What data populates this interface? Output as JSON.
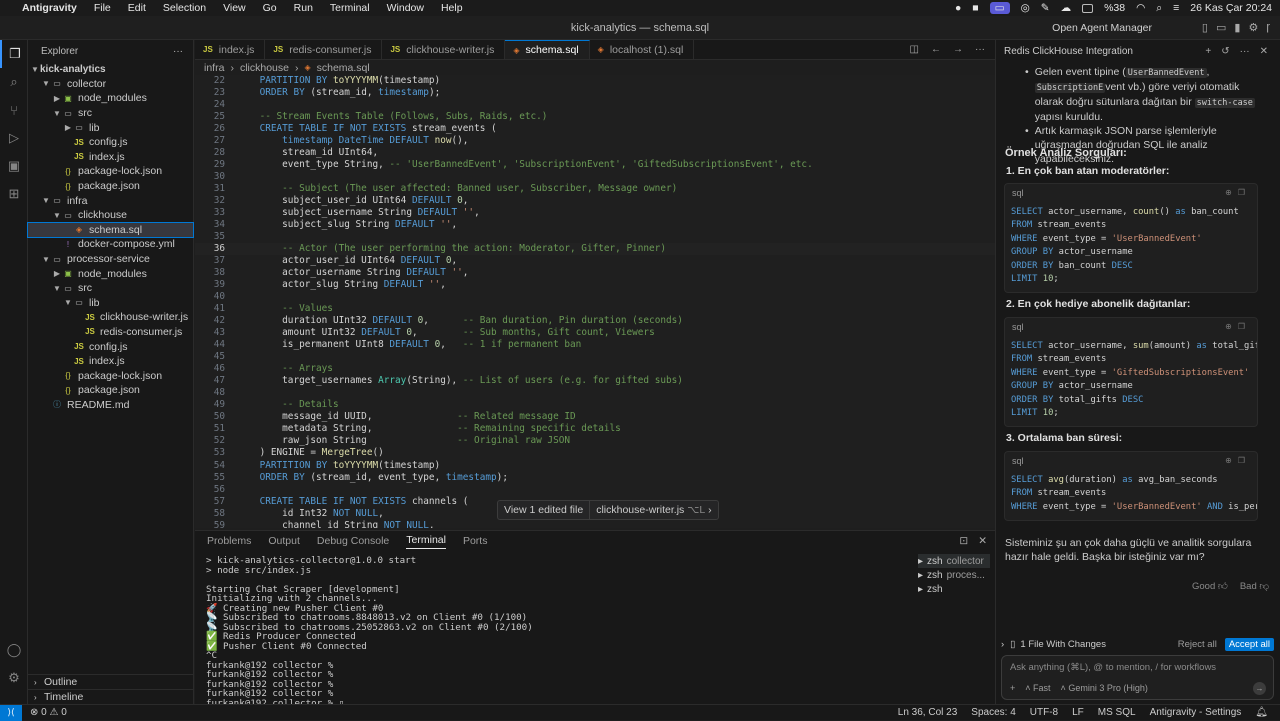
{
  "menubar": {
    "app": "Antigravity",
    "items": [
      "File",
      "Edit",
      "Selection",
      "View",
      "Go",
      "Run",
      "Terminal",
      "Window",
      "Help"
    ],
    "battery": "%38",
    "clock": "26 Kas Çar  20:24"
  },
  "window": {
    "title": "kick-analytics — schema.sql",
    "open_agent_manager": "Open Agent Manager"
  },
  "explorer": {
    "title": "Explorer",
    "root": "kick-analytics",
    "rows": [
      {
        "label": "collector",
        "kind": "folder",
        "depth": 1,
        "open": true
      },
      {
        "label": "node_modules",
        "kind": "node",
        "depth": 2,
        "open": false
      },
      {
        "label": "src",
        "kind": "folder",
        "depth": 2,
        "open": true
      },
      {
        "label": "lib",
        "kind": "folder",
        "depth": 3,
        "open": false
      },
      {
        "label": "config.js",
        "kind": "js",
        "depth": 3
      },
      {
        "label": "index.js",
        "kind": "js",
        "depth": 3
      },
      {
        "label": "package-lock.json",
        "kind": "json",
        "depth": 2
      },
      {
        "label": "package.json",
        "kind": "json",
        "depth": 2
      },
      {
        "label": "infra",
        "kind": "folder",
        "depth": 1,
        "open": true
      },
      {
        "label": "clickhouse",
        "kind": "folder",
        "depth": 2,
        "open": true
      },
      {
        "label": "schema.sql",
        "kind": "sql",
        "depth": 3,
        "selected": true
      },
      {
        "label": "docker-compose.yml",
        "kind": "yml",
        "depth": 2
      },
      {
        "label": "processor-service",
        "kind": "folder",
        "depth": 1,
        "open": true
      },
      {
        "label": "node_modules",
        "kind": "node",
        "depth": 2,
        "open": false
      },
      {
        "label": "src",
        "kind": "folder",
        "depth": 2,
        "open": true
      },
      {
        "label": "lib",
        "kind": "folder",
        "depth": 3,
        "open": true
      },
      {
        "label": "clickhouse-writer.js",
        "kind": "js",
        "depth": 4
      },
      {
        "label": "redis-consumer.js",
        "kind": "js",
        "depth": 4
      },
      {
        "label": "config.js",
        "kind": "js",
        "depth": 3
      },
      {
        "label": "index.js",
        "kind": "js",
        "depth": 3
      },
      {
        "label": "package-lock.json",
        "kind": "json",
        "depth": 2
      },
      {
        "label": "package.json",
        "kind": "json",
        "depth": 2
      },
      {
        "label": "README.md",
        "kind": "md",
        "depth": 1
      }
    ],
    "outline": "Outline",
    "timeline": "Timeline"
  },
  "tabs": [
    {
      "label": "index.js",
      "kind": "js"
    },
    {
      "label": "redis-consumer.js",
      "kind": "js"
    },
    {
      "label": "clickhouse-writer.js",
      "kind": "js"
    },
    {
      "label": "schema.sql",
      "kind": "sql",
      "active": true
    },
    {
      "label": "localhost (1).sql",
      "kind": "sql"
    }
  ],
  "breadcrumb": [
    "infra",
    "clickhouse",
    "schema.sql"
  ],
  "editor": {
    "current_line": 36,
    "lines": [
      {
        "n": 22,
        "t": [
          [
            "    ",
            ""
          ],
          [
            "PARTITION BY ",
            "kw"
          ],
          [
            "toYYYYMM",
            "fn"
          ],
          [
            "(timestamp)",
            ""
          ]
        ]
      },
      {
        "n": 23,
        "t": [
          [
            "    ",
            ""
          ],
          [
            "ORDER BY ",
            "kw"
          ],
          [
            "(stream_id, ",
            ""
          ],
          [
            "timestamp",
            "kw"
          ],
          [
            ");",
            ""
          ]
        ]
      },
      {
        "n": 24,
        "t": [
          [
            "",
            ""
          ]
        ]
      },
      {
        "n": 25,
        "t": [
          [
            "    ",
            ""
          ],
          [
            "-- Stream Events Table (Follows, Subs, Raids, etc.)",
            "cm"
          ]
        ]
      },
      {
        "n": 26,
        "t": [
          [
            "    ",
            ""
          ],
          [
            "CREATE TABLE IF NOT EXISTS ",
            "kw"
          ],
          [
            "stream_events (",
            ""
          ]
        ]
      },
      {
        "n": 27,
        "t": [
          [
            "        ",
            ""
          ],
          [
            "timestamp DateTime ",
            "kw"
          ],
          [
            "DEFAULT ",
            "kw"
          ],
          [
            "now",
            "fn"
          ],
          [
            "(),",
            ""
          ]
        ]
      },
      {
        "n": 28,
        "t": [
          [
            "        stream_id UInt64,",
            ""
          ]
        ]
      },
      {
        "n": 29,
        "t": [
          [
            "        event_type String, ",
            ""
          ],
          [
            "-- 'UserBannedEvent', 'SubscriptionEvent', 'GiftedSubscriptionsEvent', etc.",
            "cm"
          ]
        ]
      },
      {
        "n": 30,
        "t": [
          [
            "",
            ""
          ]
        ]
      },
      {
        "n": 31,
        "t": [
          [
            "        ",
            ""
          ],
          [
            "-- Subject (The user affected: Banned user, Subscriber, Message owner)",
            "cm"
          ]
        ]
      },
      {
        "n": 32,
        "t": [
          [
            "        subject_user_id UInt64 ",
            ""
          ],
          [
            "DEFAULT ",
            "kw"
          ],
          [
            "0",
            "num"
          ],
          [
            ",",
            ""
          ]
        ]
      },
      {
        "n": 33,
        "t": [
          [
            "        subject_username String ",
            ""
          ],
          [
            "DEFAULT ",
            "kw"
          ],
          [
            "''",
            "str"
          ],
          [
            ",",
            ""
          ]
        ]
      },
      {
        "n": 34,
        "t": [
          [
            "        subject_slug String ",
            ""
          ],
          [
            "DEFAULT ",
            "kw"
          ],
          [
            "''",
            "str"
          ],
          [
            ",",
            ""
          ]
        ]
      },
      {
        "n": 35,
        "t": [
          [
            "",
            ""
          ]
        ]
      },
      {
        "n": 36,
        "t": [
          [
            "        ",
            ""
          ],
          [
            "-- Actor (The user performing the action: Moderator, Gifter, Pinner)",
            "cm"
          ]
        ]
      },
      {
        "n": 37,
        "t": [
          [
            "        actor_user_id UInt64 ",
            ""
          ],
          [
            "DEFAULT ",
            "kw"
          ],
          [
            "0",
            "num"
          ],
          [
            ",",
            ""
          ]
        ]
      },
      {
        "n": 38,
        "t": [
          [
            "        actor_username String ",
            ""
          ],
          [
            "DEFAULT ",
            "kw"
          ],
          [
            "''",
            "str"
          ],
          [
            ",",
            ""
          ]
        ]
      },
      {
        "n": 39,
        "t": [
          [
            "        actor_slug String ",
            ""
          ],
          [
            "DEFAULT ",
            "kw"
          ],
          [
            "''",
            "str"
          ],
          [
            ",",
            ""
          ]
        ]
      },
      {
        "n": 40,
        "t": [
          [
            "",
            ""
          ]
        ]
      },
      {
        "n": 41,
        "t": [
          [
            "        ",
            ""
          ],
          [
            "-- Values",
            "cm"
          ]
        ]
      },
      {
        "n": 42,
        "t": [
          [
            "        duration UInt32 ",
            ""
          ],
          [
            "DEFAULT ",
            "kw"
          ],
          [
            "0",
            "num"
          ],
          [
            ",      ",
            ""
          ],
          [
            "-- Ban duration, Pin duration (seconds)",
            "cm"
          ]
        ]
      },
      {
        "n": 43,
        "t": [
          [
            "        amount UInt32 ",
            ""
          ],
          [
            "DEFAULT ",
            "kw"
          ],
          [
            "0",
            "num"
          ],
          [
            ",        ",
            ""
          ],
          [
            "-- Sub months, Gift count, Viewers",
            "cm"
          ]
        ]
      },
      {
        "n": 44,
        "t": [
          [
            "        is_permanent UInt8 ",
            ""
          ],
          [
            "DEFAULT ",
            "kw"
          ],
          [
            "0",
            "num"
          ],
          [
            ",   ",
            ""
          ],
          [
            "-- 1 if permanent ban",
            "cm"
          ]
        ]
      },
      {
        "n": 45,
        "t": [
          [
            "",
            ""
          ]
        ]
      },
      {
        "n": 46,
        "t": [
          [
            "        ",
            ""
          ],
          [
            "-- Arrays",
            "cm"
          ]
        ]
      },
      {
        "n": 47,
        "t": [
          [
            "        target_usernames ",
            ""
          ],
          [
            "Array",
            "ty"
          ],
          [
            "(String), ",
            ""
          ],
          [
            "-- List of users (e.g. for gifted subs)",
            "cm"
          ]
        ]
      },
      {
        "n": 48,
        "t": [
          [
            "",
            ""
          ]
        ]
      },
      {
        "n": 49,
        "t": [
          [
            "        ",
            ""
          ],
          [
            "-- Details",
            "cm"
          ]
        ]
      },
      {
        "n": 50,
        "t": [
          [
            "        message_id UUID,               ",
            ""
          ],
          [
            "-- Related message ID",
            "cm"
          ]
        ]
      },
      {
        "n": 51,
        "t": [
          [
            "        metadata String,               ",
            ""
          ],
          [
            "-- Remaining specific details",
            "cm"
          ]
        ]
      },
      {
        "n": 52,
        "t": [
          [
            "        raw_json String                ",
            ""
          ],
          [
            "-- Original raw JSON",
            "cm"
          ]
        ]
      },
      {
        "n": 53,
        "t": [
          [
            "    ) ENGINE = ",
            ""
          ],
          [
            "MergeTree",
            "fn"
          ],
          [
            "()",
            ""
          ]
        ]
      },
      {
        "n": 54,
        "t": [
          [
            "    ",
            ""
          ],
          [
            "PARTITION BY ",
            "kw"
          ],
          [
            "toYYYYMM",
            "fn"
          ],
          [
            "(timestamp)",
            ""
          ]
        ]
      },
      {
        "n": 55,
        "t": [
          [
            "    ",
            ""
          ],
          [
            "ORDER BY ",
            "kw"
          ],
          [
            "(stream_id, event_type, ",
            ""
          ],
          [
            "timestamp",
            "kw"
          ],
          [
            ");",
            ""
          ]
        ]
      },
      {
        "n": 56,
        "t": [
          [
            "",
            ""
          ]
        ]
      },
      {
        "n": 57,
        "t": [
          [
            "    ",
            ""
          ],
          [
            "CREATE TABLE IF NOT EXISTS ",
            "kw"
          ],
          [
            "channels (",
            ""
          ]
        ]
      },
      {
        "n": 58,
        "t": [
          [
            "        id Int32 ",
            ""
          ],
          [
            "NOT NULL",
            "kw"
          ],
          [
            ",",
            ""
          ]
        ]
      },
      {
        "n": 59,
        "t": [
          [
            "        channel_id String ",
            ""
          ],
          [
            "NOT NULL",
            "kw"
          ],
          [
            ",",
            ""
          ]
        ]
      }
    ]
  },
  "floatbar": {
    "edited": "View 1 edited file",
    "file": "clickhouse-writer.js",
    "shortcut": "⌥L"
  },
  "panel": {
    "tabs": [
      "Problems",
      "Output",
      "Debug Console",
      "Terminal",
      "Ports"
    ],
    "active": "Terminal",
    "terminal_lines": [
      "> kick-analytics-collector@1.0.0 start",
      "> node src/index.js",
      "",
      "Starting Chat Scraper [development]",
      "Initializing with 2 channels...",
      "🚀 Creating new Pusher Client #0",
      "📡 Subscribed to chatrooms.8848013.v2 on Client #0 (1/100)",
      "📡 Subscribed to chatrooms.25052863.v2 on Client #0 (2/100)",
      "✅ Redis Producer Connected",
      "✅ Pusher Client #0 Connected",
      "^C",
      "furkank@192 collector %",
      "furkank@192 collector %",
      "furkank@192 collector %",
      "furkank@192 collector %",
      "furkank@192 collector % ▯"
    ],
    "terminals": [
      {
        "name": "zsh",
        "sub": "collector"
      },
      {
        "name": "zsh",
        "sub": "proces..."
      },
      {
        "name": "zsh",
        "sub": ""
      }
    ]
  },
  "agent": {
    "title": "Redis ClickHouse Integration",
    "bullet1_a": "Gelen event tipine (",
    "bullet1_code1": "UserBannedEvent",
    "bullet1_b": ", ",
    "bullet1_code2": "SubscriptionE",
    "bullet1_c": "vent vb.) göre veriyi otomatik olarak doğru sütunlara dağıtan bir ",
    "bullet1_code3": "switch-case",
    "bullet1_d": " yapısı kuruldu.",
    "bullet2": "Artık karmaşık JSON parse işlemleriyle uğraşmadan doğrudan SQL ile analiz yapabileceksiniz.",
    "heading": "Örnek Analiz Sorguları:",
    "q1": "1. En çok ban atan moderatörler:",
    "q2": "2. En çok hediye abonelik dağıtanlar:",
    "q3": "3. Ortalama ban süresi:",
    "lang": "sql",
    "sql1": [
      "SELECT actor_username, count() as ban_count",
      "FROM stream_events",
      "WHERE event_type = 'UserBannedEvent'",
      "GROUP BY actor_username",
      "ORDER BY ban_count DESC",
      "LIMIT 10;"
    ],
    "sql2": [
      "SELECT actor_username, sum(amount) as total_gifts",
      "FROM stream_events",
      "WHERE event_type = 'GiftedSubscriptionsEvent'",
      "GROUP BY actor_username",
      "ORDER BY total_gifts DESC",
      "LIMIT 10;"
    ],
    "sql3": [
      "SELECT avg(duration) as avg_ban_seconds",
      "FROM stream_events",
      "WHERE event_type = 'UserBannedEvent' AND is_permanen"
    ],
    "closing": "Sisteminiz şu an çok daha güçlü ve analitik sorgulara hazır hale geldi. Başka bir isteğiniz var mı?",
    "good": "Good",
    "bad": "Bad",
    "changes": "1 File With Changes",
    "reject_all": "Reject all",
    "accept_all": "Accept all",
    "input_placeholder": "Ask anything (⌘L), @ to mention, / for workflows",
    "mode": "Fast",
    "model": "Gemini 3 Pro (High)"
  },
  "status": {
    "errors": "0",
    "warnings": "0",
    "position": "Ln 36, Col 23",
    "spaces": "Spaces: 4",
    "encoding": "UTF-8",
    "eol": "LF",
    "language": "MS SQL",
    "settings": "Antigravity - Settings"
  }
}
